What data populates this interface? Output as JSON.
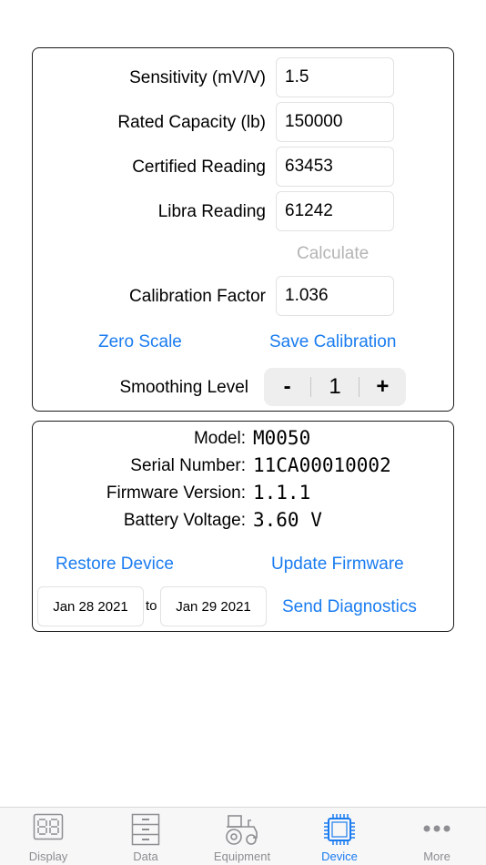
{
  "calibration": {
    "sensitivity": {
      "label": "Sensitivity (mV/V)",
      "value": "1.5"
    },
    "rated_capacity": {
      "label": "Rated Capacity (lb)",
      "value": "150000"
    },
    "certified_reading": {
      "label": "Certified Reading",
      "value": "63453"
    },
    "libra_reading": {
      "label": "Libra Reading",
      "value": "61242"
    },
    "calculate_label": "Calculate",
    "calibration_factor": {
      "label": "Calibration Factor",
      "value": "1.036"
    },
    "zero_scale_label": "Zero Scale",
    "save_calibration_label": "Save Calibration",
    "smoothing": {
      "label": "Smoothing Level",
      "minus": "-",
      "value": "1",
      "plus": "+"
    }
  },
  "device": {
    "model": {
      "label": "Model:",
      "value": "M0050"
    },
    "serial": {
      "label": "Serial Number:",
      "value": "11CA00010002"
    },
    "firmware": {
      "label": "Firmware Version:",
      "value": "1.1.1"
    },
    "battery": {
      "label": "Battery Voltage:",
      "value": "3.60 V"
    },
    "restore_label": "Restore Device",
    "update_label": "Update Firmware",
    "date_from": "Jan 28 2021",
    "date_to_word": "to",
    "date_to": "Jan 29 2021",
    "send_diagnostics_label": "Send Diagnostics"
  },
  "tabs": [
    {
      "label": "Display",
      "icon": "seven-segment-icon",
      "active": false
    },
    {
      "label": "Data",
      "icon": "file-cabinet-icon",
      "active": false
    },
    {
      "label": "Equipment",
      "icon": "tractor-icon",
      "active": false
    },
    {
      "label": "Device",
      "icon": "chip-icon",
      "active": true
    },
    {
      "label": "More",
      "icon": "more-dots-icon",
      "active": false
    }
  ],
  "colors": {
    "accent": "#1a7cf0",
    "inactive_tab": "#8e8e93",
    "disabled": "#b4b4b4"
  }
}
